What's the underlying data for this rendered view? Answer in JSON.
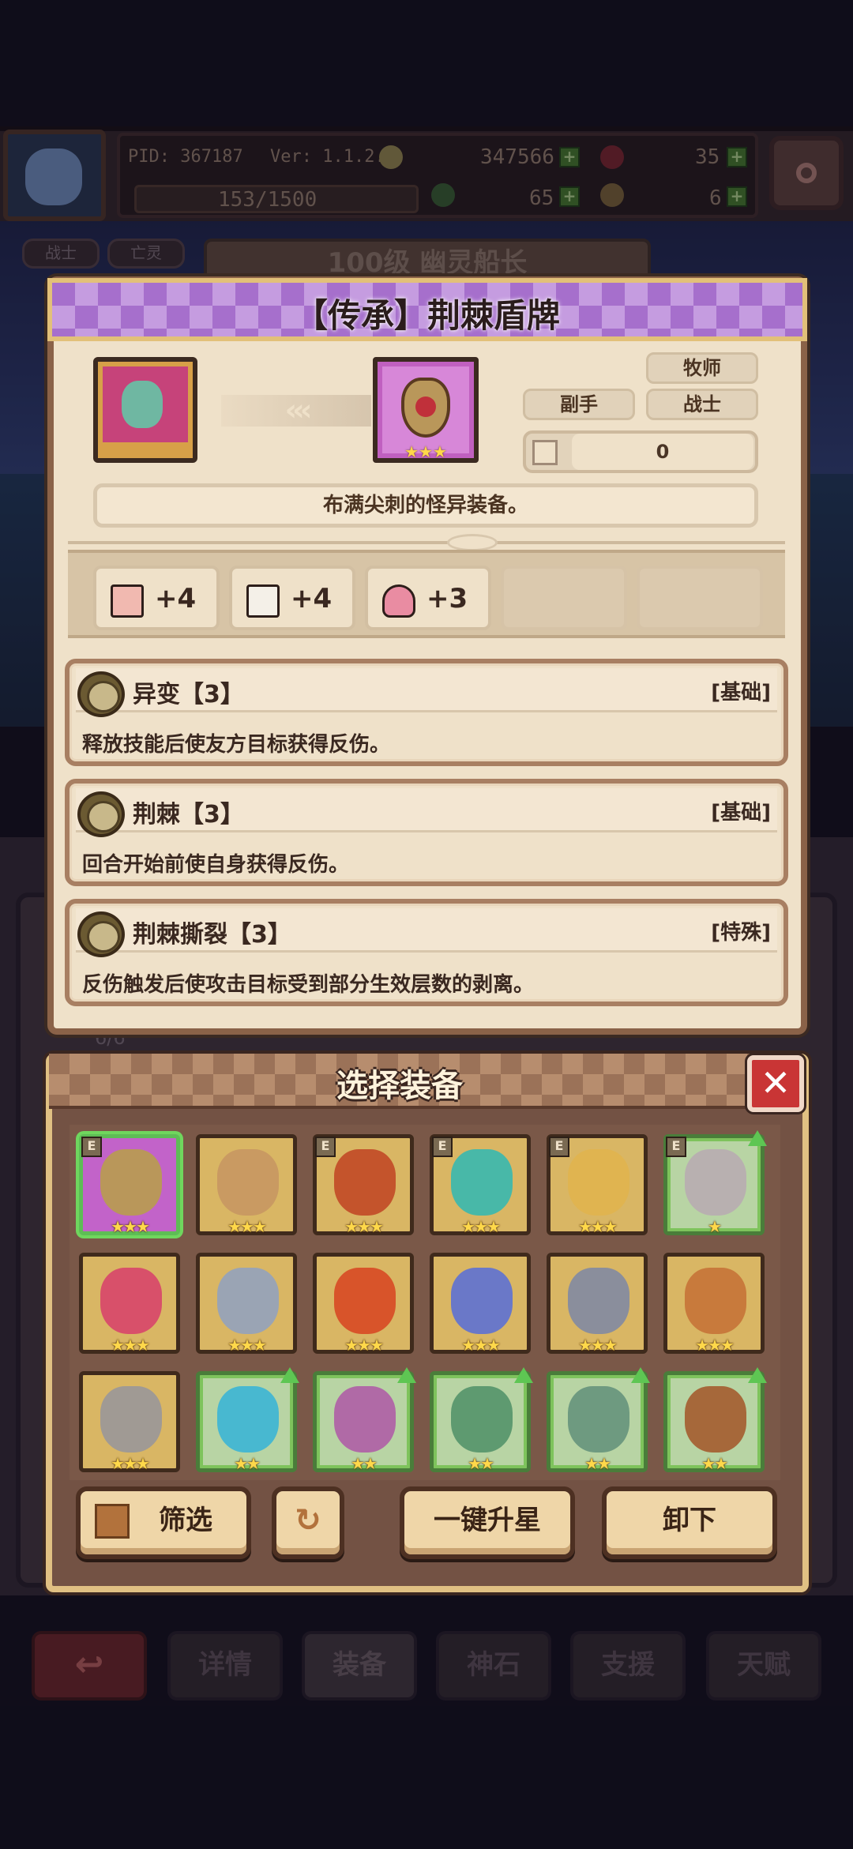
{
  "header": {
    "pid": "PID: 367187",
    "version": "Ver: 1.1.2.0",
    "gold": "347566",
    "gems": "35",
    "exp": "153/1500",
    "clover": "65",
    "keys": "6"
  },
  "background": {
    "tag1": "战士",
    "tag2": "亡灵",
    "hero_title": "100级 幽灵船长",
    "progress": "6/6",
    "nav": [
      "详情",
      "装备",
      "神石",
      "支援",
      "天赋"
    ]
  },
  "item_detail": {
    "title": "【传承】荆棘盾牌",
    "classes": [
      "牧师",
      "战士"
    ],
    "slot": "副手",
    "count": "0",
    "stars": "★★★",
    "description": "布满尖刺的怪异装备。",
    "stats": [
      {
        "icon": "fist-icon",
        "value": "+4"
      },
      {
        "icon": "book-icon",
        "value": "+4"
      },
      {
        "icon": "heart-icon",
        "value": "+3"
      }
    ],
    "traits": [
      {
        "name": "异变【3】",
        "tag": "[基础]",
        "text": "释放技能后使友方目标获得反伤。"
      },
      {
        "name": "荆棘【3】",
        "tag": "[基础]",
        "text": "回合开始前使自身获得反伤。"
      },
      {
        "name": "荆棘撕裂【3】",
        "tag": "[特殊]",
        "text": "反伤触发后使攻击目标受到部分生效层数的剥离。"
      }
    ]
  },
  "select_panel": {
    "title": "选择装备",
    "close": "✕",
    "items": [
      {
        "name": "thorn-shield",
        "stars": "★★★",
        "e": "E",
        "up": false,
        "green": false,
        "selected": true,
        "color": "#b9975a"
      },
      {
        "name": "gold-crest",
        "stars": "★★★",
        "e": "",
        "up": false,
        "green": false,
        "selected": false,
        "color": "#c99a62"
      },
      {
        "name": "fire-barrel",
        "stars": "★★★",
        "e": "E",
        "up": false,
        "green": false,
        "selected": false,
        "color": "#c4542c"
      },
      {
        "name": "crystal-gem",
        "stars": "★★★",
        "e": "E",
        "up": false,
        "green": false,
        "selected": false,
        "color": "#48b8a8"
      },
      {
        "name": "holy-shield",
        "stars": "★★★",
        "e": "E",
        "up": false,
        "green": false,
        "selected": false,
        "color": "#e0b450"
      },
      {
        "name": "iron-armor",
        "stars": "★",
        "e": "E",
        "up": true,
        "green": true,
        "selected": false,
        "color": "#b8b0b0"
      },
      {
        "name": "teddy-bear",
        "stars": "★★★",
        "e": "",
        "up": false,
        "green": false,
        "selected": false,
        "color": "#d8506a"
      },
      {
        "name": "crossed-swords",
        "stars": "★★★",
        "e": "",
        "up": false,
        "green": false,
        "selected": false,
        "color": "#9aa4b4"
      },
      {
        "name": "lava-shield",
        "stars": "★★★",
        "e": "",
        "up": false,
        "green": false,
        "selected": false,
        "color": "#d8542a"
      },
      {
        "name": "blue-staff",
        "stars": "★★★",
        "e": "",
        "up": false,
        "green": false,
        "selected": false,
        "color": "#6a78c8"
      },
      {
        "name": "dagger",
        "stars": "★★★",
        "e": "",
        "up": false,
        "green": false,
        "selected": false,
        "color": "#8a8e9c"
      },
      {
        "name": "golden-chest",
        "stars": "★★★",
        "e": "",
        "up": false,
        "green": false,
        "selected": false,
        "color": "#c87a3c"
      },
      {
        "name": "spear",
        "stars": "★★★",
        "e": "",
        "up": false,
        "green": false,
        "selected": false,
        "color": "#a09a94"
      },
      {
        "name": "ice-shield",
        "stars": "★★",
        "e": "",
        "up": true,
        "green": true,
        "selected": false,
        "color": "#48b8d0"
      },
      {
        "name": "pink-orb",
        "stars": "★★",
        "e": "",
        "up": true,
        "green": true,
        "selected": false,
        "color": "#b06aa6"
      },
      {
        "name": "green-lantern",
        "stars": "★★",
        "e": "",
        "up": true,
        "green": true,
        "selected": false,
        "color": "#5e9a70"
      },
      {
        "name": "stone-shield",
        "stars": "★★",
        "e": "",
        "up": true,
        "green": true,
        "selected": false,
        "color": "#6e9a80"
      },
      {
        "name": "horned-armor",
        "stars": "★★",
        "e": "",
        "up": true,
        "green": true,
        "selected": false,
        "color": "#a6683a"
      }
    ],
    "buttons": {
      "filter": "筛选",
      "upgrade_all": "一键升星",
      "unequip": "卸下"
    }
  },
  "colors": {
    "accent_purple": "#a66fcc",
    "panel_brown": "#735244",
    "parchment": "#efe1c9",
    "close_red": "#c93535",
    "upgrade_green": "#5ec653",
    "star": "#ffd84a"
  }
}
